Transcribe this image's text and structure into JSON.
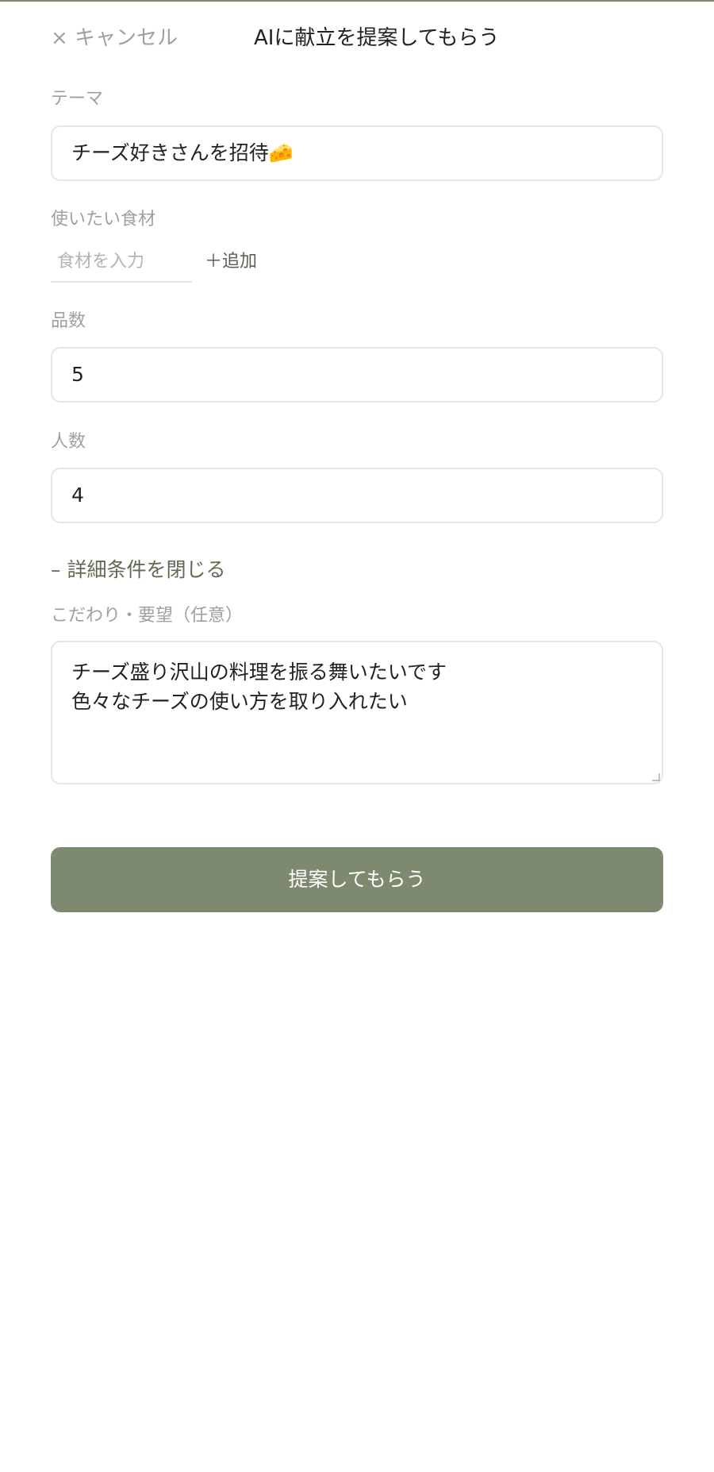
{
  "header": {
    "cancel_label": "× キャンセル",
    "title": "AIに献立を提案してもらう"
  },
  "form": {
    "theme": {
      "label": "テーマ",
      "value": "チーズ好きさんを招待🧀"
    },
    "ingredients": {
      "label": "使いたい食材",
      "placeholder": "食材を入力",
      "add_label": "＋追加"
    },
    "dish_count": {
      "label": "品数",
      "value": "5"
    },
    "people_count": {
      "label": "人数",
      "value": "4"
    },
    "details_toggle_label": "– 詳細条件を閉じる",
    "requests": {
      "label": "こだわり・要望（任意）",
      "lines": [
        "チーズ盛り沢山の料理を振る舞いたいです",
        "色々なチーズの使い方を取り入れたい"
      ]
    },
    "submit_label": "提案してもらう"
  },
  "colors": {
    "accent": "#7e8a6f",
    "label_gray": "#a0a0a0",
    "border": "#e6e6e6"
  }
}
